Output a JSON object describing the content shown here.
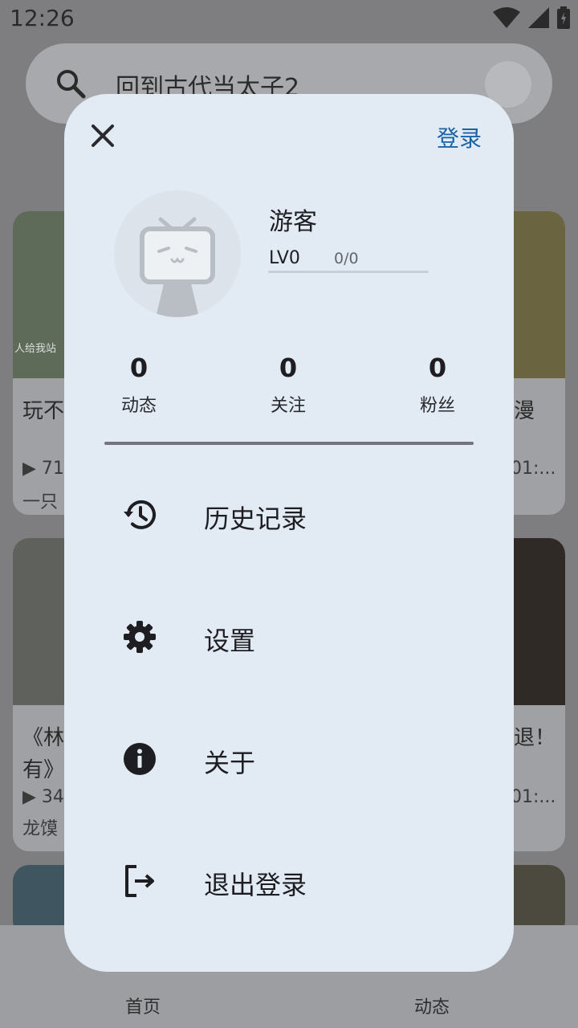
{
  "status_bar": {
    "time": "12:26"
  },
  "search": {
    "query": "回到古代当太子2"
  },
  "background_cards": [
    {
      "title": "玩不",
      "meta1": "▶ 71",
      "meta2": "一只",
      "overlay": "人给我站"
    },
    {
      "title": "漫",
      "meta1": "01:..."
    },
    {
      "title": "《林",
      "title2": "有》",
      "meta1": "▶ 34",
      "meta2": "龙馍"
    },
    {
      "title": "退！",
      "meta1": "01:..."
    }
  ],
  "bottom_nav": {
    "home": "首页",
    "dynamic": "动态"
  },
  "dialog": {
    "login_label": "登录",
    "user": {
      "name": "游客",
      "level": "LV0",
      "exp": "0/0",
      "exp_fraction": 0
    },
    "stats": [
      {
        "value": "0",
        "label": "动态"
      },
      {
        "value": "0",
        "label": "关注"
      },
      {
        "value": "0",
        "label": "粉丝"
      }
    ],
    "menu": [
      {
        "label": "历史记录",
        "icon": "history-icon"
      },
      {
        "label": "设置",
        "icon": "gear-icon"
      },
      {
        "label": "关于",
        "icon": "info-icon"
      },
      {
        "label": "退出登录",
        "icon": "logout-icon"
      }
    ]
  },
  "colors": {
    "accent": "#1b63a5",
    "dialog_bg": "#e2eaf4",
    "scrim": "#7e7e80"
  }
}
